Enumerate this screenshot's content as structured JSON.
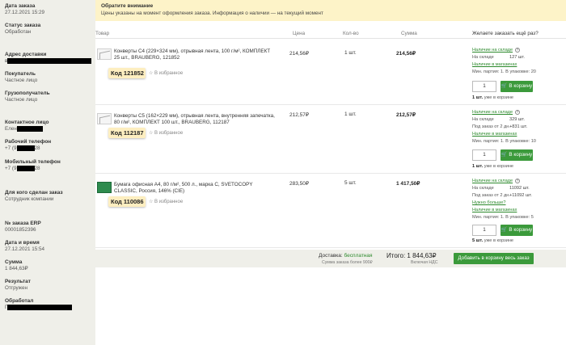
{
  "sidebar": {
    "order_date": {
      "label": "Дата заказа",
      "value": "27.12.2021 15:29"
    },
    "status": {
      "label": "Статус заказа",
      "value": "Обработан"
    },
    "address": {
      "label": "Адрес доставки",
      "value": "в"
    },
    "buyer": {
      "label": "Покупатель",
      "value": "Частное лицо"
    },
    "consignee": {
      "label": "Грузополучатель",
      "value": "Частное лицо"
    },
    "contact": {
      "label": "Контактное лицо",
      "value": "Елен"
    },
    "work_phone": {
      "label": "Рабочий телефон",
      "value_prefix": "+7 (9",
      "value_suffix": "28"
    },
    "mobile_phone": {
      "label": "Мобильный телефон",
      "value_prefix": "+7 (9",
      "value_suffix": "28"
    },
    "made_for": {
      "label": "Для кого сделан заказ",
      "value": "Сотрудник компании"
    },
    "erp": {
      "label": "№ заказа ERP",
      "value": "00001852396"
    },
    "datetime": {
      "label": "Дата и время",
      "value": "27.12.2021 15:54"
    },
    "amount": {
      "label": "Сумма",
      "value": "1 844,63₽"
    },
    "result": {
      "label": "Результат",
      "value": "Отгружен"
    },
    "processed": {
      "label": "Обработал",
      "value": "Г"
    }
  },
  "notice": {
    "title": "Обратите внимание",
    "text": "Цены указаны на момент оформления заказа. Информация о наличии — на текущий момент"
  },
  "table_headers": {
    "product": "Товар",
    "price": "Цена",
    "qty": "Кол-во",
    "sum": "Сумма",
    "ask": "Желаете заказать ещё раз?"
  },
  "rows": [
    {
      "name": "Конверты С4 (229×324 мм), отрывная лента, 100 г/м², КОМПЛЕКТ 25 шт., BRAUBERG, 121852",
      "code": "Код 121852",
      "fav": "В избранное",
      "price": "214,56₽",
      "qty": "1 шт.",
      "sum": "214,56₽",
      "avail": [
        {
          "text": "Наличие на складе",
          "link": true,
          "info": true
        },
        {
          "text": "На складе",
          "value": "127 шт."
        },
        {
          "text": "Наличие в магазинах",
          "link": true
        },
        {
          "text": "Мин. партия: 1. В упаковке: 20"
        }
      ],
      "qty_input": "1",
      "cart_label": "В корзину",
      "in_cart_bold": "1 шт.",
      "in_cart_rest": " уже в корзине"
    },
    {
      "name": "Конверты С5 (162×229 мм), отрывная лента, внутренняя запечатка, 80 г/м², КОМПЛЕКТ 100 шт., BRAUBERG, 112187",
      "code": "Код 112187",
      "fav": "В избранное",
      "price": "212,57₽",
      "qty": "1 шт.",
      "sum": "212,57₽",
      "avail": [
        {
          "text": "Наличие на складе",
          "link": true,
          "info": true
        },
        {
          "text": "На складе",
          "value": "329 шт."
        },
        {
          "text": "Под заказ от 2 дн.",
          "value": "+831 шт."
        },
        {
          "text": "Наличие в магазинах",
          "link": true
        },
        {
          "text": "Мин. партия: 1. В упаковке: 10"
        }
      ],
      "qty_input": "1",
      "cart_label": "В корзину",
      "in_cart_bold": "1 шт.",
      "in_cart_rest": " уже в корзине"
    },
    {
      "name": "Бумага офисная А4, 80 г/м², 500 л., марка С, SVETOCOPY CLASSIC, Россия, 146% (CIE)",
      "code": "Код 110086",
      "fav": "В избранное",
      "price": "283,50₽",
      "qty": "5 шт.",
      "sum": "1 417,50₽",
      "avail": [
        {
          "text": "Наличие на складе",
          "link": true,
          "info": true
        },
        {
          "text": "На складе",
          "value": "11092 шт."
        },
        {
          "text": "Под заказ от 2 дн.",
          "value": "+11092 шт."
        },
        {
          "text": "Нужно больше?",
          "link": true
        },
        {
          "text": "Наличие в магазинах",
          "link": true
        },
        {
          "text": "Мин. партия: 1. В упаковке: 5"
        }
      ],
      "qty_input": "1",
      "cart_label": "В корзину",
      "in_cart_bold": "5 шт.",
      "in_cart_rest": " уже в корзине"
    }
  ],
  "footer": {
    "delivery_label": "Доставка: ",
    "delivery_value": "бесплатная",
    "delivery_sub": "Сумма заказа более 900₽",
    "total": "Итого: 1 844,63₽",
    "total_sub": "Включая НДС",
    "add_all": "Добавить в корзину весь заказ"
  }
}
